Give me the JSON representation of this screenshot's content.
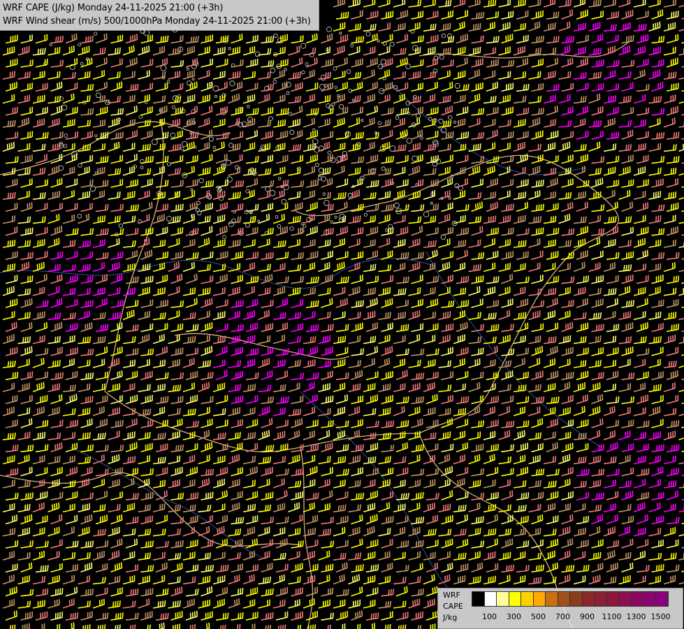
{
  "titles": {
    "line1": "WRF CAPE (J/kg) Monday 24-11-2025 21:00 (+3h)",
    "line2": "WRF Wind shear (m/s) 500/1000hPa Monday 24-11-2025 21:00 (+3h)"
  },
  "legend": {
    "label1": "WRF",
    "label2": "CAPE",
    "label3": "J/kg",
    "colors": [
      "#000000",
      "#ffffff",
      "#ffff99",
      "#ffff00",
      "#ffd000",
      "#ffaa00",
      "#c87010",
      "#a05018",
      "#8c3c1e",
      "#8c2828",
      "#8c2034",
      "#8c1840",
      "#8c1050",
      "#8c0860",
      "#8c0470",
      "#8c0080"
    ],
    "ticks": [
      "100",
      "300",
      "500",
      "700",
      "900",
      "1100",
      "1300",
      "1500"
    ]
  },
  "barb_colors": {
    "low": "#ffff00",
    "light": "#ffff66",
    "mid": "#c89664",
    "salmon": "#f07c78",
    "high": "#ff00ff"
  }
}
